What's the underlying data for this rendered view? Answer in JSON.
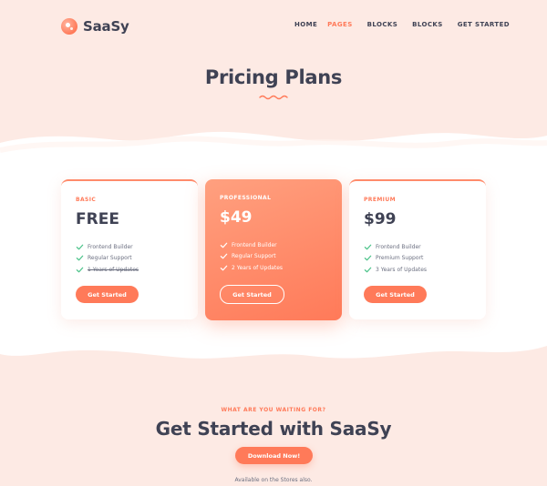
{
  "brand": {
    "name": "SaaSy",
    "accent": "#ff7a59"
  },
  "nav": {
    "items": [
      {
        "label": "HOME",
        "active": false
      },
      {
        "label": "PAGES",
        "active": true
      },
      {
        "label": "BLOCKS",
        "active": false
      },
      {
        "label": "BLOCKS",
        "active": false
      },
      {
        "label": "GET STARTED",
        "active": false
      }
    ]
  },
  "hero": {
    "title": "Pricing Plans"
  },
  "plans": [
    {
      "tier": "BASIC",
      "price": "FREE",
      "features": [
        {
          "label": "Frontend Builder",
          "struck": false
        },
        {
          "label": "Regular Support",
          "struck": false
        },
        {
          "label": "1 Years of Updates",
          "struck": true
        }
      ],
      "button": "Get Started"
    },
    {
      "tier": "PROFESSIONAL",
      "price": "$49",
      "features": [
        {
          "label": "Frontend Builder",
          "struck": false
        },
        {
          "label": "Regular Support",
          "struck": false
        },
        {
          "label": "2 Years of Updates",
          "struck": false
        }
      ],
      "button": "Get Started"
    },
    {
      "tier": "PREMIUM",
      "price": "$99",
      "features": [
        {
          "label": "Frontend Builder",
          "struck": false
        },
        {
          "label": "Premium Support",
          "struck": false
        },
        {
          "label": "3 Years of Updates",
          "struck": false
        }
      ],
      "button": "Get Started"
    }
  ],
  "cta": {
    "eyebrow": "WHAT ARE YOU WAITING FOR?",
    "title": "Get Started with SaaSy",
    "button": "Download Now!",
    "note": "Available on the Stores also."
  },
  "icons": {
    "logo": "logo-mark-icon",
    "check": "check-icon",
    "squiggle": "squiggle-underline-icon"
  }
}
